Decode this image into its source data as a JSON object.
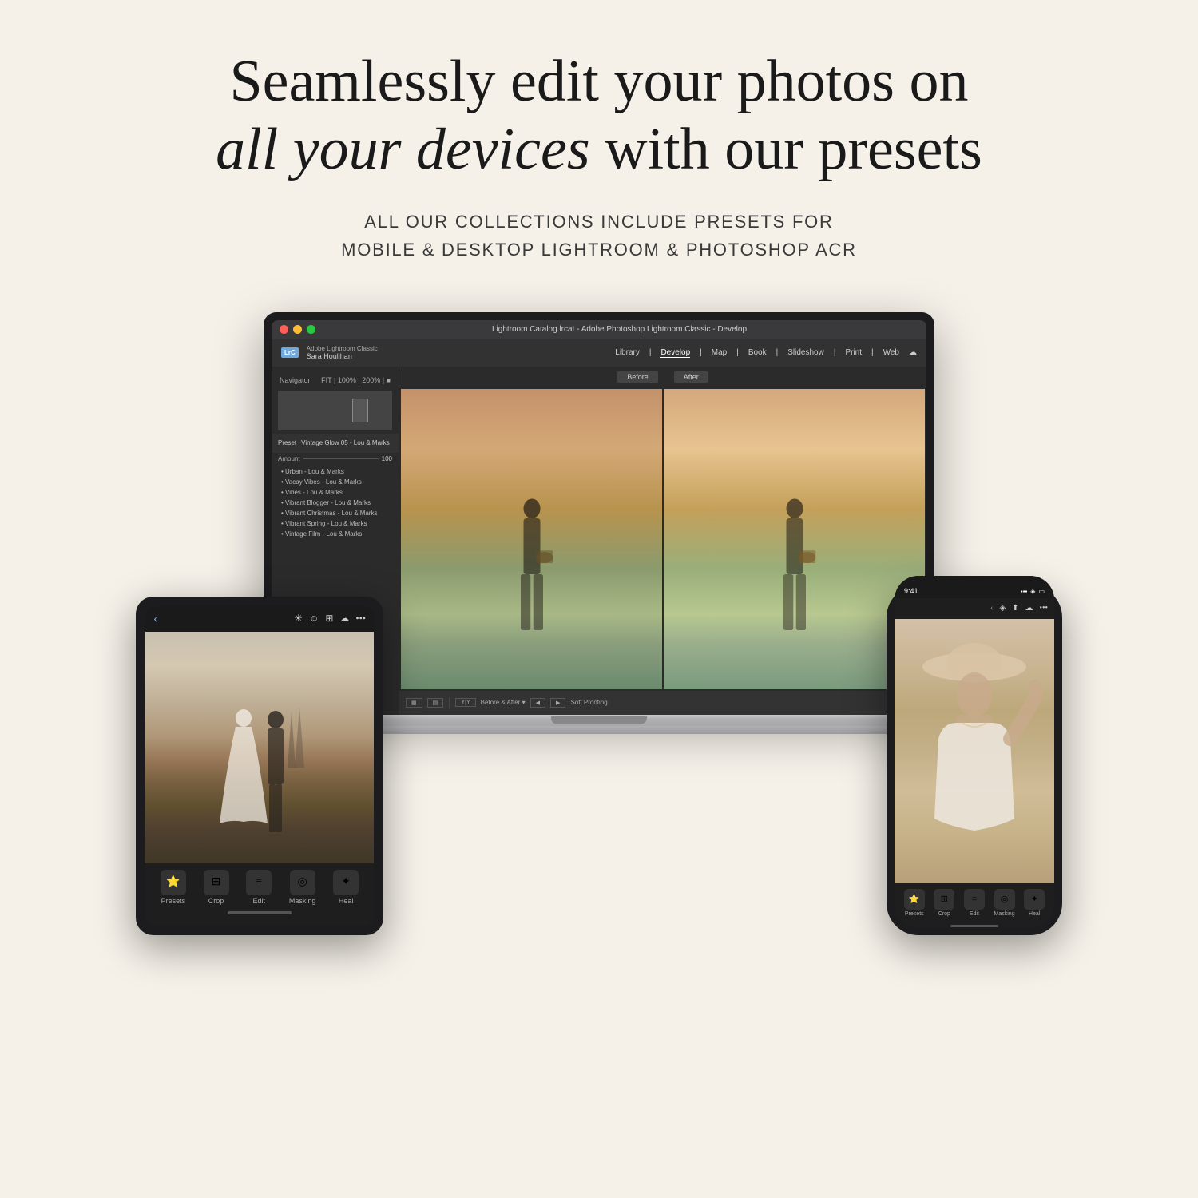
{
  "page": {
    "background_color": "#f5f0e8"
  },
  "headline": {
    "line1": "Seamlessly edit your photos on",
    "line2_italic": "all your devices",
    "line2_normal": " with our presets"
  },
  "subtitle": {
    "line1": "ALL OUR COLLECTIONS INCLUDE PRESETS FOR",
    "line2": "MOBILE & DESKTOP LIGHTROOM & PHOTOSHOP ACR"
  },
  "laptop": {
    "titlebar_text": "Lightroom Catalog.lrcat - Adobe Photoshop Lightroom Classic - Develop",
    "logo": "LrC",
    "user_name": "Sara Houlihan",
    "app_name": "Adobe Lightroom Classic",
    "nav_items": [
      "Library",
      "Develop",
      "Map",
      "Book",
      "Slideshow",
      "Print",
      "Web"
    ],
    "active_nav": "Develop",
    "panel_title": "Navigator",
    "preset_section_label": "Preset",
    "preset_name": "Vintage Glow 05 - Lou & Marks",
    "amount_label": "Amount",
    "amount_value": "100",
    "preset_list": [
      "Urban - Lou & Marks",
      "Vacay Vibes - Lou & Marks",
      "Vibes - Lou & Marks",
      "Vibrant Blogger - Lou & Marks",
      "Vibrant Christmas - Lou & Marks",
      "Vibrant Spring - Lou & Marks",
      "Vintage Film - Lou & Marks"
    ],
    "before_label": "Before",
    "after_label": "After",
    "bottom_label": "Before & After"
  },
  "ipad": {
    "bottom_tools": [
      "Presets",
      "Crop",
      "Edit",
      "Masking",
      "Heal"
    ],
    "tool_icons": [
      "⭐",
      "✂️",
      "🔧",
      "🎭",
      "✨"
    ]
  },
  "iphone": {
    "time": "9:41",
    "bottom_tools": [
      "Presets",
      "Crop",
      "Edit",
      "Masking",
      "Heal"
    ],
    "tool_icons": [
      "⭐",
      "✂️",
      "🔧",
      "🎭",
      "✨"
    ]
  }
}
